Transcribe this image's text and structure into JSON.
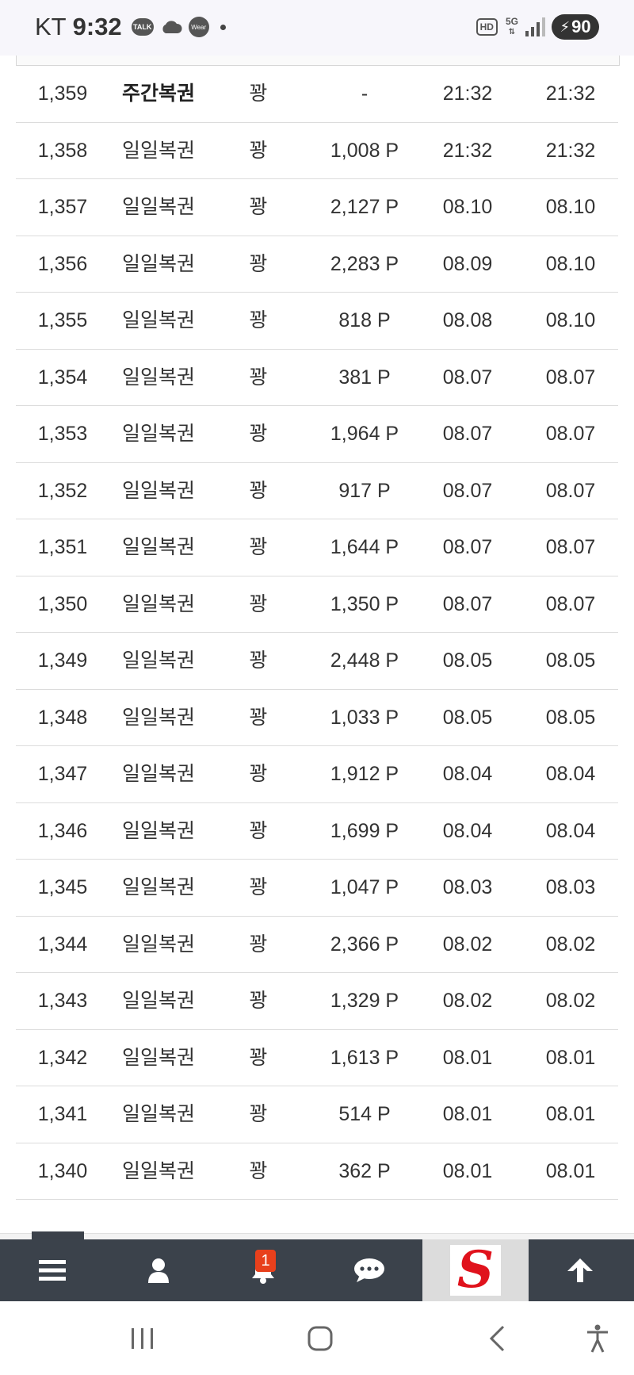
{
  "status_bar": {
    "carrier": "KT",
    "time": "9:32",
    "talk_label": "TALK",
    "wear_label": "Wear",
    "hd_label": "HD",
    "network": "5G",
    "battery": "90"
  },
  "rows": [
    {
      "no": "1,359",
      "type": "주간복권",
      "result": "꽝",
      "amount": "-",
      "buy": "21:32",
      "check": "21:32"
    },
    {
      "no": "1,358",
      "type": "일일복권",
      "result": "꽝",
      "amount": "1,008 P",
      "buy": "21:32",
      "check": "21:32"
    },
    {
      "no": "1,357",
      "type": "일일복권",
      "result": "꽝",
      "amount": "2,127 P",
      "buy": "08.10",
      "check": "08.10"
    },
    {
      "no": "1,356",
      "type": "일일복권",
      "result": "꽝",
      "amount": "2,283 P",
      "buy": "08.09",
      "check": "08.10"
    },
    {
      "no": "1,355",
      "type": "일일복권",
      "result": "꽝",
      "amount": "818 P",
      "buy": "08.08",
      "check": "08.10"
    },
    {
      "no": "1,354",
      "type": "일일복권",
      "result": "꽝",
      "amount": "381 P",
      "buy": "08.07",
      "check": "08.07"
    },
    {
      "no": "1,353",
      "type": "일일복권",
      "result": "꽝",
      "amount": "1,964 P",
      "buy": "08.07",
      "check": "08.07"
    },
    {
      "no": "1,352",
      "type": "일일복권",
      "result": "꽝",
      "amount": "917 P",
      "buy": "08.07",
      "check": "08.07"
    },
    {
      "no": "1,351",
      "type": "일일복권",
      "result": "꽝",
      "amount": "1,644 P",
      "buy": "08.07",
      "check": "08.07"
    },
    {
      "no": "1,350",
      "type": "일일복권",
      "result": "꽝",
      "amount": "1,350 P",
      "buy": "08.07",
      "check": "08.07"
    },
    {
      "no": "1,349",
      "type": "일일복권",
      "result": "꽝",
      "amount": "2,448 P",
      "buy": "08.05",
      "check": "08.05"
    },
    {
      "no": "1,348",
      "type": "일일복권",
      "result": "꽝",
      "amount": "1,033 P",
      "buy": "08.05",
      "check": "08.05"
    },
    {
      "no": "1,347",
      "type": "일일복권",
      "result": "꽝",
      "amount": "1,912 P",
      "buy": "08.04",
      "check": "08.04"
    },
    {
      "no": "1,346",
      "type": "일일복권",
      "result": "꽝",
      "amount": "1,699 P",
      "buy": "08.04",
      "check": "08.04"
    },
    {
      "no": "1,345",
      "type": "일일복권",
      "result": "꽝",
      "amount": "1,047 P",
      "buy": "08.03",
      "check": "08.03"
    },
    {
      "no": "1,344",
      "type": "일일복권",
      "result": "꽝",
      "amount": "2,366 P",
      "buy": "08.02",
      "check": "08.02"
    },
    {
      "no": "1,343",
      "type": "일일복권",
      "result": "꽝",
      "amount": "1,329 P",
      "buy": "08.02",
      "check": "08.02"
    },
    {
      "no": "1,342",
      "type": "일일복권",
      "result": "꽝",
      "amount": "1,613 P",
      "buy": "08.01",
      "check": "08.01"
    },
    {
      "no": "1,341",
      "type": "일일복권",
      "result": "꽝",
      "amount": "514 P",
      "buy": "08.01",
      "check": "08.01"
    },
    {
      "no": "1,340",
      "type": "일일복권",
      "result": "꽝",
      "amount": "362 P",
      "buy": "08.01",
      "check": "08.01"
    }
  ],
  "bottom_nav": {
    "items": [
      {
        "icon": "menu-icon"
      },
      {
        "icon": "user-icon"
      },
      {
        "icon": "bell-icon",
        "badge": "1"
      },
      {
        "icon": "chat-icon"
      },
      {
        "icon": "site-logo",
        "logo_text": "S"
      },
      {
        "icon": "arrow-up-icon"
      }
    ]
  },
  "colors": {
    "nav_bg": "#3b424b",
    "badge": "#e8401c",
    "logo_red": "#e0121c"
  }
}
